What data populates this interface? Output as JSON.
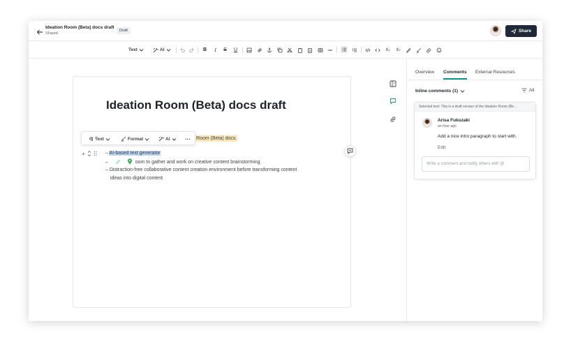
{
  "header": {
    "title": "Ideation Room (Beta) docs draft",
    "subtitle": "Shared",
    "badge": "Draft",
    "share_label": "Share"
  },
  "toolbar": {
    "text_label": "Text",
    "ai_label": "AI",
    "icons": [
      "undo-icon",
      "redo-icon",
      "bold-icon",
      "italic-icon",
      "strikethrough-icon",
      "underline-icon",
      "image-icon",
      "link-icon",
      "anchor-icon",
      "copy-icon",
      "cut-icon",
      "paste-icon",
      "paste-text-icon",
      "table-icon",
      "horizontal-rule-icon",
      "bullet-list-icon",
      "numbered-list-icon",
      "code-icon",
      "code-block-icon",
      "subscript-icon",
      "superscript-icon",
      "highlighter-icon",
      "brush-icon",
      "eraser-icon",
      "emoji-icon"
    ]
  },
  "editor": {
    "heading": "Ideation Room (Beta) docs draft",
    "floating_toolbar": {
      "text_label": "Text",
      "format_label": "Format",
      "ai_label": "AI"
    },
    "highlighted_line": "Room (Beta) docs.",
    "bullets": [
      {
        "dash": "–",
        "text": "AI-based text generator"
      },
      {
        "dash": "–",
        "text": "oom to gather and work on creative content brainstorming"
      },
      {
        "dash": "–",
        "text": "Distraction-free collaborative content creation environment before transforming content"
      },
      {
        "dash": "",
        "text": "ideas into digital content"
      }
    ]
  },
  "panel": {
    "tabs": [
      {
        "label": "Overview",
        "active": false
      },
      {
        "label": "Comments",
        "active": true
      },
      {
        "label": "External Resources",
        "active": false
      }
    ],
    "inline_comments_label": "Inline comments (1)",
    "filter_label": "All",
    "comment": {
      "selected_text": "Selected text: This is a draft version of the Ideation Room (Be...",
      "author": "Arisa Fukuzaki",
      "time": "an hour ago",
      "body": "Add a nice intro paragraph to start with.",
      "edit_label": "Edit",
      "reply_placeholder": "Write a comment and notify others with @"
    }
  },
  "colors": {
    "accent": "#0f9488",
    "share_button": "#1f2937",
    "highlight": "#fbe8b8",
    "selection": "#bcd6f7"
  }
}
